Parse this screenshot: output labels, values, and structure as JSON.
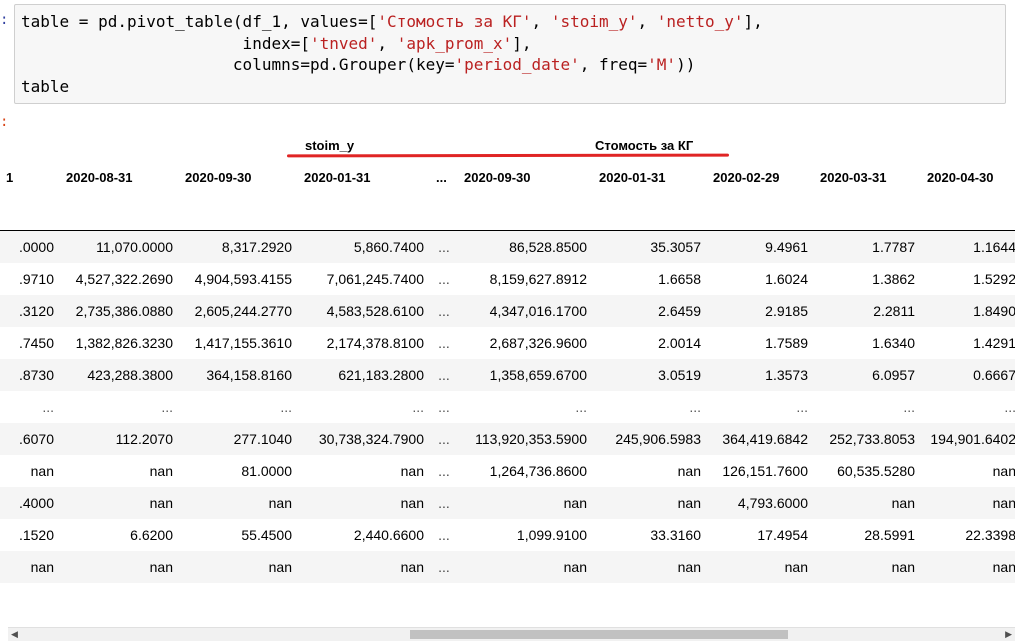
{
  "prompts": {
    "in": ":",
    "out": ":"
  },
  "code": {
    "l1a": "table = pd.pivot_table(df_1, values=[",
    "s1": "'Стомость за КГ'",
    "c1": ", ",
    "s2": "'stoim_y'",
    "c2": ", ",
    "s3": "'netto_y'",
    "e1": "],",
    "l2a": "                       index=[",
    "s4": "'tnved'",
    "c3": ", ",
    "s5": "'apk_prom_x'",
    "e2": "],",
    "l3a": "                      columns=pd.Grouper(key=",
    "s6": "'period_date'",
    "c4": ", freq=",
    "s7": "'M'",
    "e3": "))",
    "l4": "table"
  },
  "output": {
    "group_labels": {
      "stoim": "stoim_y",
      "cost": "Стомость за КГ"
    },
    "columns": [
      "1",
      "2020-08-31",
      "2020-09-30",
      "2020-01-31",
      "...",
      "2020-09-30",
      "2020-01-31",
      "2020-02-29",
      "2020-03-31",
      "2020-04-30"
    ],
    "rows": [
      [
        ".0000",
        "11,070.0000",
        "8,317.2920",
        "5,860.7400",
        "...",
        "86,528.8500",
        "35.3057",
        "9.4961",
        "1.7787",
        "1.1644"
      ],
      [
        ".9710",
        "4,527,322.2690",
        "4,904,593.4155",
        "7,061,245.7400",
        "...",
        "8,159,627.8912",
        "1.6658",
        "1.6024",
        "1.3862",
        "1.5292"
      ],
      [
        ".3120",
        "2,735,386.0880",
        "2,605,244.2770",
        "4,583,528.6100",
        "...",
        "4,347,016.1700",
        "2.6459",
        "2.9185",
        "2.2811",
        "1.8490"
      ],
      [
        ".7450",
        "1,382,826.3230",
        "1,417,155.3610",
        "2,174,378.8100",
        "...",
        "2,687,326.9600",
        "2.0014",
        "1.7589",
        "1.6340",
        "1.4291"
      ],
      [
        ".8730",
        "423,288.3800",
        "364,158.8160",
        "621,183.2800",
        "...",
        "1,358,659.6700",
        "3.0519",
        "1.3573",
        "6.0957",
        "0.6667"
      ],
      [
        "...",
        "...",
        "...",
        "...",
        "...",
        "...",
        "...",
        "...",
        "...",
        "..."
      ],
      [
        ".6070",
        "112.2070",
        "277.1040",
        "30,738,324.7900",
        "...",
        "113,920,353.5900",
        "245,906.5983",
        "364,419.6842",
        "252,733.8053",
        "194,901.6402"
      ],
      [
        "nan",
        "nan",
        "81.0000",
        "nan",
        "...",
        "1,264,736.8600",
        "nan",
        "126,151.7600",
        "60,535.5280",
        "nan"
      ],
      [
        ".4000",
        "nan",
        "nan",
        "nan",
        "...",
        "nan",
        "nan",
        "4,793.6000",
        "nan",
        "nan"
      ],
      [
        ".1520",
        "6.6200",
        "55.4500",
        "2,440.6600",
        "...",
        "1,099.9100",
        "33.3160",
        "17.4954",
        "28.5991",
        "22.3398"
      ],
      [
        "nan",
        "nan",
        "nan",
        "nan",
        "...",
        "nan",
        "nan",
        "nan",
        "nan",
        "nan"
      ]
    ]
  },
  "scrollbar": {
    "left_arrow": "◀",
    "right_arrow": "▶"
  }
}
